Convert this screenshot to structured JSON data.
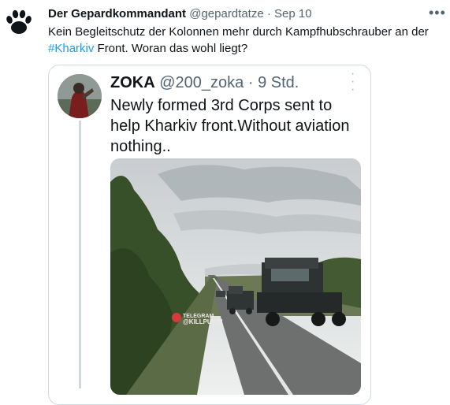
{
  "tweet": {
    "display_name": "Der Gepardkommandant",
    "handle": "@gepardtatze",
    "separator": "·",
    "date": "Sep 10",
    "more_icon": "more-icon",
    "text_before": "Kein Begleitschutz der Kolonnen mehr durch Kampfhubschrauber an der",
    "hashtag": "#Kharkiv",
    "text_after": " Front. Woran das wohl liegt?"
  },
  "quoted": {
    "display_name": "ZOKA",
    "handle": "@200_zoka",
    "separator": "·",
    "date": "9 Std.",
    "text": "Newly formed 3rd Corps sent to help Kharkiv front.Without aviation nothing..",
    "watermark_line1": "TELEGRAM",
    "watermark_line2": "@KILLPUKIN"
  },
  "colors": {
    "accent": "#1d9bf0",
    "text": "#0f1419",
    "secondary": "#536471",
    "border": "#cfd9de"
  }
}
